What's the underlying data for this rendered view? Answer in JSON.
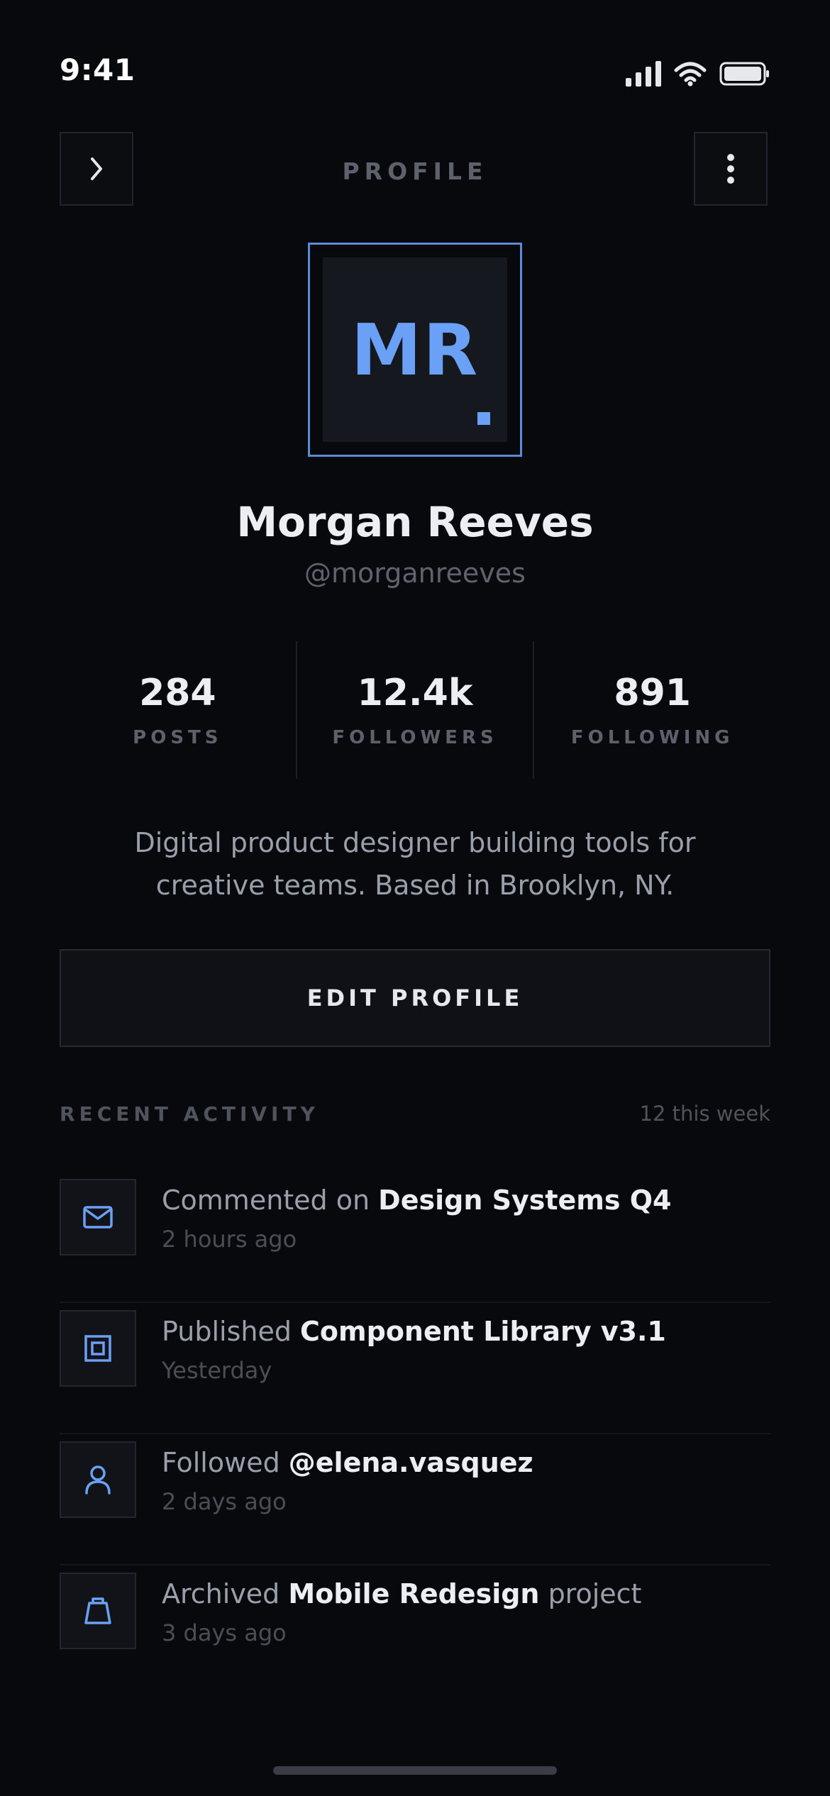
{
  "status_bar": {
    "time": "9:41",
    "icons": [
      "cellular-signal-icon",
      "wifi-icon",
      "battery-icon"
    ]
  },
  "header": {
    "title": "PROFILE",
    "back_icon": "chevron-right-icon",
    "menu_icon": "more-vertical-icon"
  },
  "profile": {
    "initials": "MR",
    "name": "Morgan Reeves",
    "handle": "@morganreeves",
    "bio": "Digital product designer building tools for creative teams. Based in Brooklyn, NY."
  },
  "stats": [
    {
      "value": "284",
      "label": "POSTS"
    },
    {
      "value": "12.4k",
      "label": "FOLLOWERS"
    },
    {
      "value": "891",
      "label": "FOLLOWING"
    }
  ],
  "actions": {
    "edit_profile": "EDIT PROFILE"
  },
  "activity": {
    "title": "RECENT ACTIVITY",
    "count": "12 this week",
    "items": [
      {
        "icon": "mail-icon",
        "prefix": "Commented on ",
        "target": "Design Systems Q4",
        "suffix": "",
        "time": "2 hours ago"
      },
      {
        "icon": "layers-icon",
        "prefix": "Published ",
        "target": "Component Library v3.1",
        "suffix": "",
        "time": "Yesterday"
      },
      {
        "icon": "user-icon",
        "prefix": "Followed ",
        "target": "@elena.vasquez",
        "suffix": "",
        "time": "2 days ago"
      },
      {
        "icon": "archive-icon",
        "prefix": "Archived ",
        "target": "Mobile Redesign",
        "suffix": " project",
        "time": "3 days ago"
      }
    ]
  },
  "colors": {
    "background": "#08090c",
    "accent": "#6aa0f5",
    "text_primary": "#eceef3",
    "text_secondary": "#9aa0ab",
    "text_muted": "#4f535c"
  }
}
